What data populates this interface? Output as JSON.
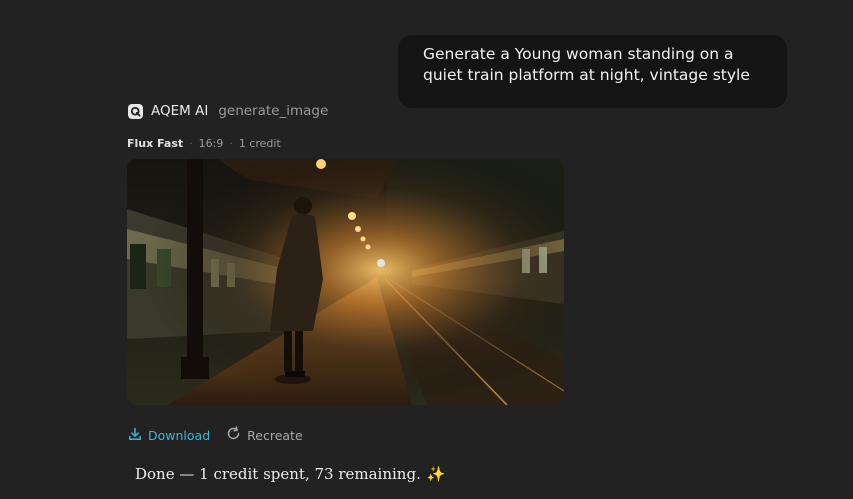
{
  "user_message": {
    "line1": "Generate a Young woman standing on a",
    "line2": "quiet train platform at night, vintage style"
  },
  "assistant": {
    "name": "AQEM AI",
    "tool": "generate_image",
    "logo_icon": "aqem-logo-icon"
  },
  "generation_meta": {
    "model": "Flux Fast",
    "aspect_ratio": "16:9",
    "cost": "1 credit",
    "separator": "·"
  },
  "image": {
    "alt": "Young woman standing on a quiet train platform at night, vintage style"
  },
  "actions": {
    "download_label": "Download",
    "download_icon": "download-icon",
    "recreate_label": "Recreate",
    "recreate_icon": "refresh-icon"
  },
  "status": {
    "text": "Done — 1 credit spent, 73 remaining.",
    "emoji": "✨"
  },
  "colors": {
    "background": "#222222",
    "user_bubble": "#141414",
    "accent": "#3fb6d8"
  }
}
